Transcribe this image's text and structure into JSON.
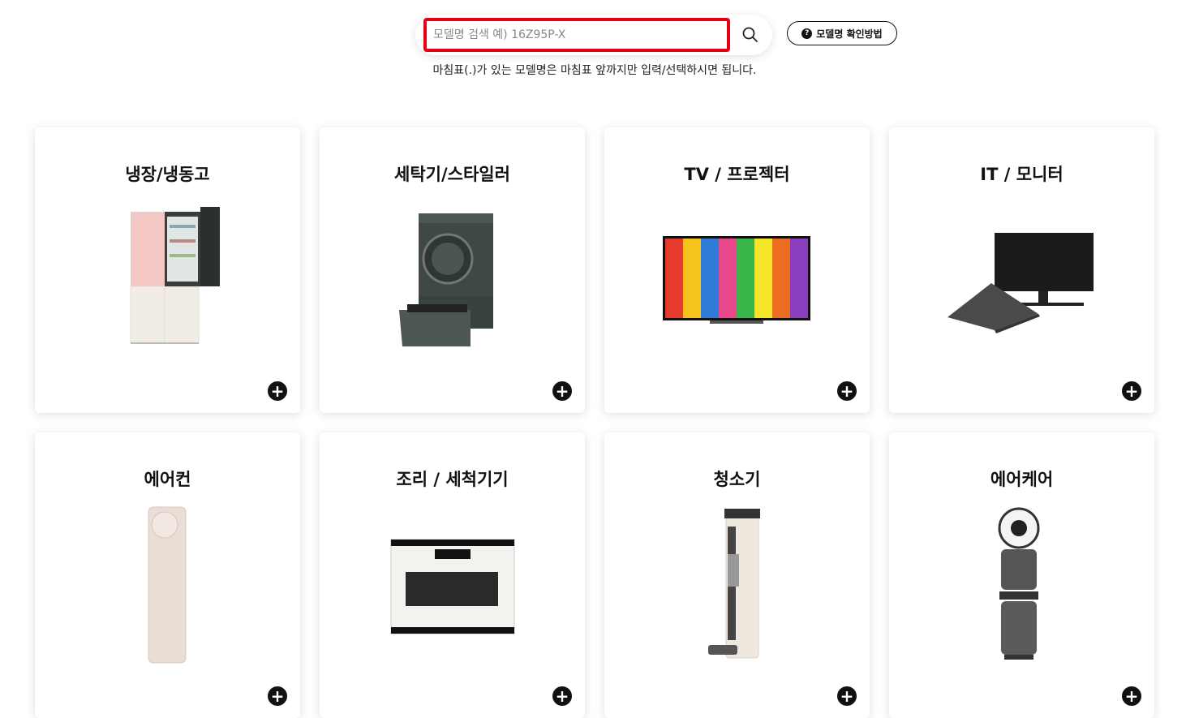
{
  "search": {
    "placeholder": "모델명 검색 예) 16Z95P-X",
    "howto_label": "모델명 확인방법",
    "howto_icon": "question-icon",
    "hint": "마침표(.)가 있는 모델명은 마침표 앞까지만 입력/선택하시면 됩니다."
  },
  "categories": [
    {
      "label": "냉장/냉동고",
      "icon": "refrigerator-image"
    },
    {
      "label": "세탁기/스타일러",
      "icon": "washer-image"
    },
    {
      "label": "TV / 프로젝터",
      "icon": "tv-image"
    },
    {
      "label": "IT / 모니터",
      "icon": "laptop-monitor-image"
    },
    {
      "label": "에어컨",
      "icon": "air-conditioner-image"
    },
    {
      "label": "조리 / 세척기기",
      "icon": "oven-image"
    },
    {
      "label": "청소기",
      "icon": "vacuum-image"
    },
    {
      "label": "에어케어",
      "icon": "air-purifier-image"
    }
  ],
  "colors": {
    "accent": "#e60012",
    "text": "#111111"
  }
}
